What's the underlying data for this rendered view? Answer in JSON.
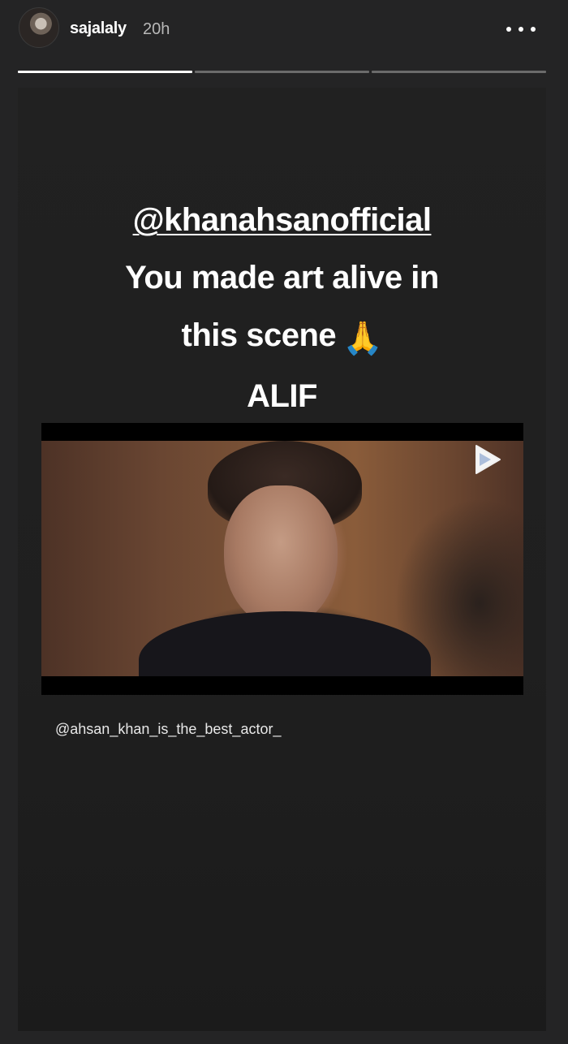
{
  "header": {
    "username": "sajalaly",
    "timestamp": "20h",
    "progress_segments": [
      1.0,
      0.0,
      0.0
    ]
  },
  "story": {
    "mention": "@khanahsanofficial",
    "line2": "You made art alive in",
    "line3": "this scene",
    "line3_emoji": "🙏",
    "line4": "ALIF",
    "credit": "@ahsan_khan_is_the_best_actor_"
  },
  "icons": {
    "more": "more-options-icon",
    "play": "play-icon",
    "avatar": "avatar"
  },
  "colors": {
    "background": "#242425",
    "text": "#ffffff",
    "muted": "#b8b8b8"
  }
}
